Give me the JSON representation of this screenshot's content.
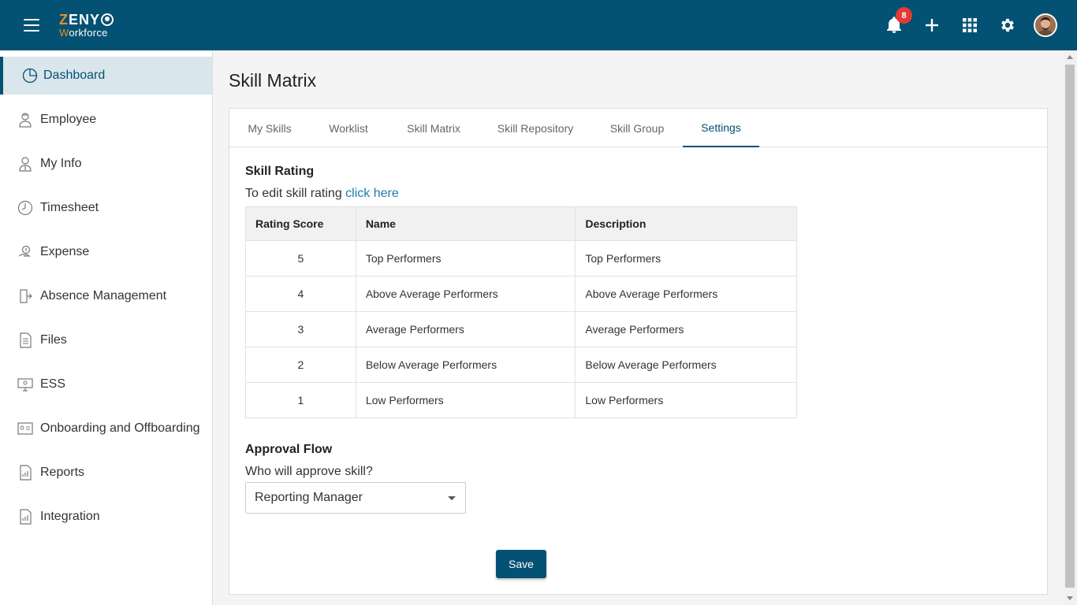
{
  "app": {
    "logo_top_letters": "ZENY",
    "logo_sub": "orkforce",
    "logo_sub_first": "W",
    "notifications_count": "8"
  },
  "colors": {
    "header_bg": "#035173",
    "accent": "#035173",
    "link": "#1f7cad",
    "badge": "#e53935",
    "logo_orange": "#f08a24"
  },
  "sidebar": {
    "items": [
      {
        "label": "Dashboard",
        "icon": "pie-chart-icon",
        "active": true
      },
      {
        "label": "Employee",
        "icon": "employee-icon"
      },
      {
        "label": "My Info",
        "icon": "user-info-icon"
      },
      {
        "label": "Timesheet",
        "icon": "clock-icon"
      },
      {
        "label": "Expense",
        "icon": "money-hand-icon"
      },
      {
        "label": "Absence Management",
        "icon": "exit-door-icon"
      },
      {
        "label": "Files",
        "icon": "file-icon"
      },
      {
        "label": "ESS",
        "icon": "monitor-user-icon"
      },
      {
        "label": "Onboarding and Offboarding",
        "icon": "id-card-icon"
      },
      {
        "label": "Reports",
        "icon": "report-icon"
      },
      {
        "label": "Integration",
        "icon": "integration-icon"
      }
    ]
  },
  "page": {
    "title": "Skill Matrix"
  },
  "tabs": [
    {
      "label": "My Skills"
    },
    {
      "label": "Worklist"
    },
    {
      "label": "Skill Matrix"
    },
    {
      "label": "Skill Repository"
    },
    {
      "label": "Skill Group"
    },
    {
      "label": "Settings",
      "active": true
    }
  ],
  "skill_rating": {
    "title": "Skill Rating",
    "helper_text": "To edit skill rating ",
    "helper_link": "click here",
    "columns": [
      "Rating Score",
      "Name",
      "Description"
    ],
    "rows": [
      {
        "score": "5",
        "name": "Top Performers",
        "description": "Top Performers"
      },
      {
        "score": "4",
        "name": "Above Average Performers",
        "description": "Above Average Performers"
      },
      {
        "score": "3",
        "name": "Average Performers",
        "description": "Average Performers"
      },
      {
        "score": "2",
        "name": "Below Average Performers",
        "description": "Below Average Performers"
      },
      {
        "score": "1",
        "name": "Low Performers",
        "description": "Low Performers"
      }
    ]
  },
  "approval_flow": {
    "title": "Approval Flow",
    "question": "Who will approve skill?",
    "selected": "Reporting Manager"
  },
  "actions": {
    "save_label": "Save"
  }
}
